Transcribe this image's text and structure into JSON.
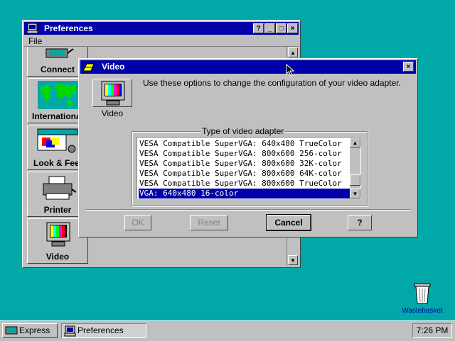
{
  "prefs_window": {
    "title": "Preferences",
    "menu": {
      "file": "File"
    },
    "titlebar_buttons": {
      "help": "?",
      "minimize": "_",
      "maximize": "□",
      "close": "×"
    },
    "items": [
      {
        "label": "Connect",
        "icon": "network-plug-icon"
      },
      {
        "label": "International",
        "icon": "world-map-icon"
      },
      {
        "label": "Look & Feel",
        "icon": "look-and-feel-icon"
      },
      {
        "label": "Printer",
        "icon": "printer-icon"
      },
      {
        "label": "Video",
        "icon": "monitor-icon"
      }
    ]
  },
  "video_dialog": {
    "title": "Video",
    "close": "×",
    "icon_label": "Video",
    "description": "Use these options to change the configuration of your video adapter.",
    "group_title": "Type of video adapter",
    "adapters": [
      "VESA Compatible SuperVGA: 640x480 TrueColor",
      "VESA Compatible SuperVGA: 800x600 256-color",
      "VESA Compatible SuperVGA: 800x600 32K-color",
      "VESA Compatible SuperVGA: 800x600 64K-color",
      "VESA Compatible SuperVGA: 800x600 TrueColor",
      "VGA: 640x480 16-color"
    ],
    "selected_index": 5,
    "buttons": {
      "ok": "OK",
      "reset": "Reset",
      "cancel": "Cancel",
      "help": "?"
    }
  },
  "desktop": {
    "trash_label": "Wastebasket"
  },
  "taskbar": {
    "express": "Express",
    "preferences": "Preferences",
    "clock": "7:26 PM"
  },
  "colors": {
    "desktop": "#00a8a8",
    "titlebar": "#0000a8",
    "face": "#c0c0c0",
    "selection": "#0000a8"
  }
}
